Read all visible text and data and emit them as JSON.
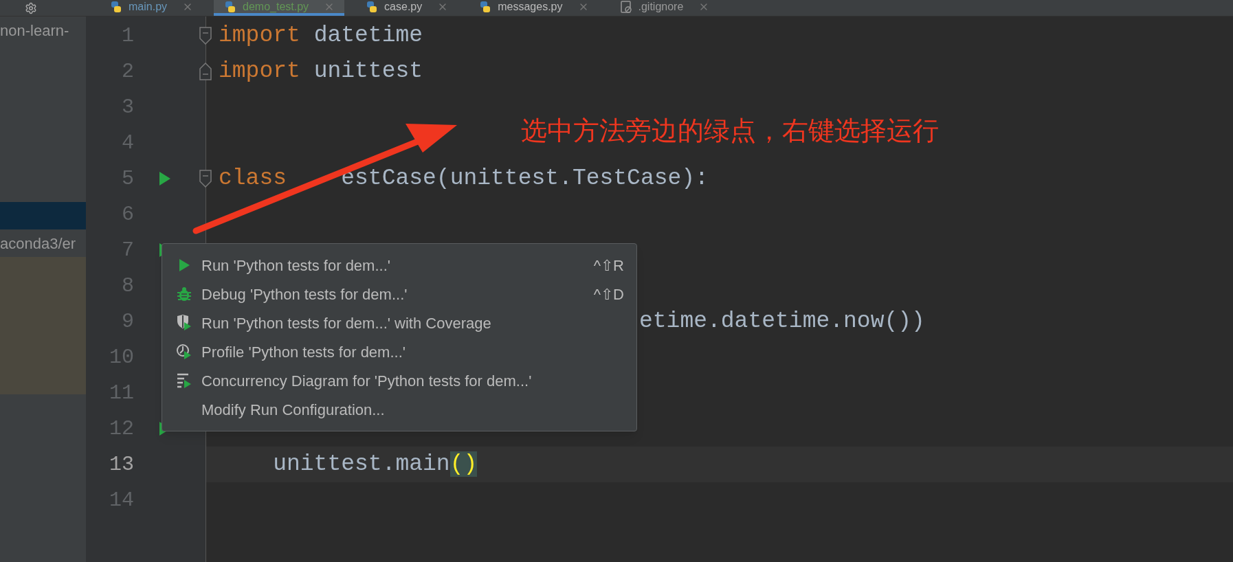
{
  "tabs": [
    {
      "label": "main.py",
      "color": "#6897bb",
      "selected": false
    },
    {
      "label": "demo_test.py",
      "color": "#629755",
      "selected": true
    },
    {
      "label": "case.py",
      "color": "#bbbbbb",
      "selected": false
    },
    {
      "label": "messages.py",
      "color": "#bbbbbb",
      "selected": false
    },
    {
      "label": ".gitignore",
      "color": "#999999",
      "selected": false,
      "kind": "ignored"
    }
  ],
  "project_panel": {
    "rows": [
      {
        "text": "non-learn-",
        "selected": false
      },
      {
        "selected": true
      },
      {
        "text": "aconda3/er",
        "selected": false
      }
    ]
  },
  "editor": {
    "lines": [
      {
        "number": "1",
        "fold_start": true,
        "tokens": [
          {
            "kind": "keyword",
            "text": "import"
          },
          {
            "kind": "plain",
            "text": " datetime"
          }
        ]
      },
      {
        "number": "2",
        "fold_end": true,
        "tokens": [
          {
            "kind": "keyword",
            "text": "import"
          },
          {
            "kind": "plain",
            "text": " unittest"
          }
        ]
      },
      {
        "number": "3"
      },
      {
        "number": "4"
      },
      {
        "number": "5",
        "run_marker": true,
        "fold_start": true,
        "tokens": [
          {
            "kind": "keyword",
            "text": "class"
          },
          {
            "kind": "covered"
          },
          {
            "kind": "plain",
            "text": "estCase(unittest.TestCase):"
          }
        ]
      },
      {
        "number": "6"
      },
      {
        "number": "7",
        "run_marker": true
      },
      {
        "number": "8"
      },
      {
        "number": "9",
        "after_popup": true,
        "tokens": [
          {
            "kind": "plain",
            "text": "etime.datetime.now())"
          }
        ]
      },
      {
        "number": "10"
      },
      {
        "number": "11"
      },
      {
        "number": "12",
        "run_marker": true
      },
      {
        "number": "13",
        "current": true,
        "tokens": [
          {
            "kind": "plain",
            "text": "    unittest.main"
          },
          {
            "kind": "match",
            "text": "("
          },
          {
            "kind": "match",
            "text": ")"
          }
        ]
      },
      {
        "number": "14"
      }
    ]
  },
  "context_menu": {
    "items": [
      {
        "kind": "run",
        "label": "Run 'Python tests for dem...'",
        "shortcut": "^⇧R"
      },
      {
        "kind": "debug",
        "label": "Debug 'Python tests for dem...'",
        "shortcut": "^⇧D"
      },
      {
        "kind": "coverage",
        "label": "Run 'Python tests for dem...' with Coverage"
      },
      {
        "kind": "profile",
        "label": "Profile 'Python tests for dem...'"
      },
      {
        "kind": "concurrency",
        "label": "Concurrency Diagram for 'Python tests for dem...'"
      },
      {
        "label": "Modify Run Configuration..."
      }
    ]
  },
  "annotation": {
    "text": "选中方法旁边的绿点，右键选择运行"
  }
}
